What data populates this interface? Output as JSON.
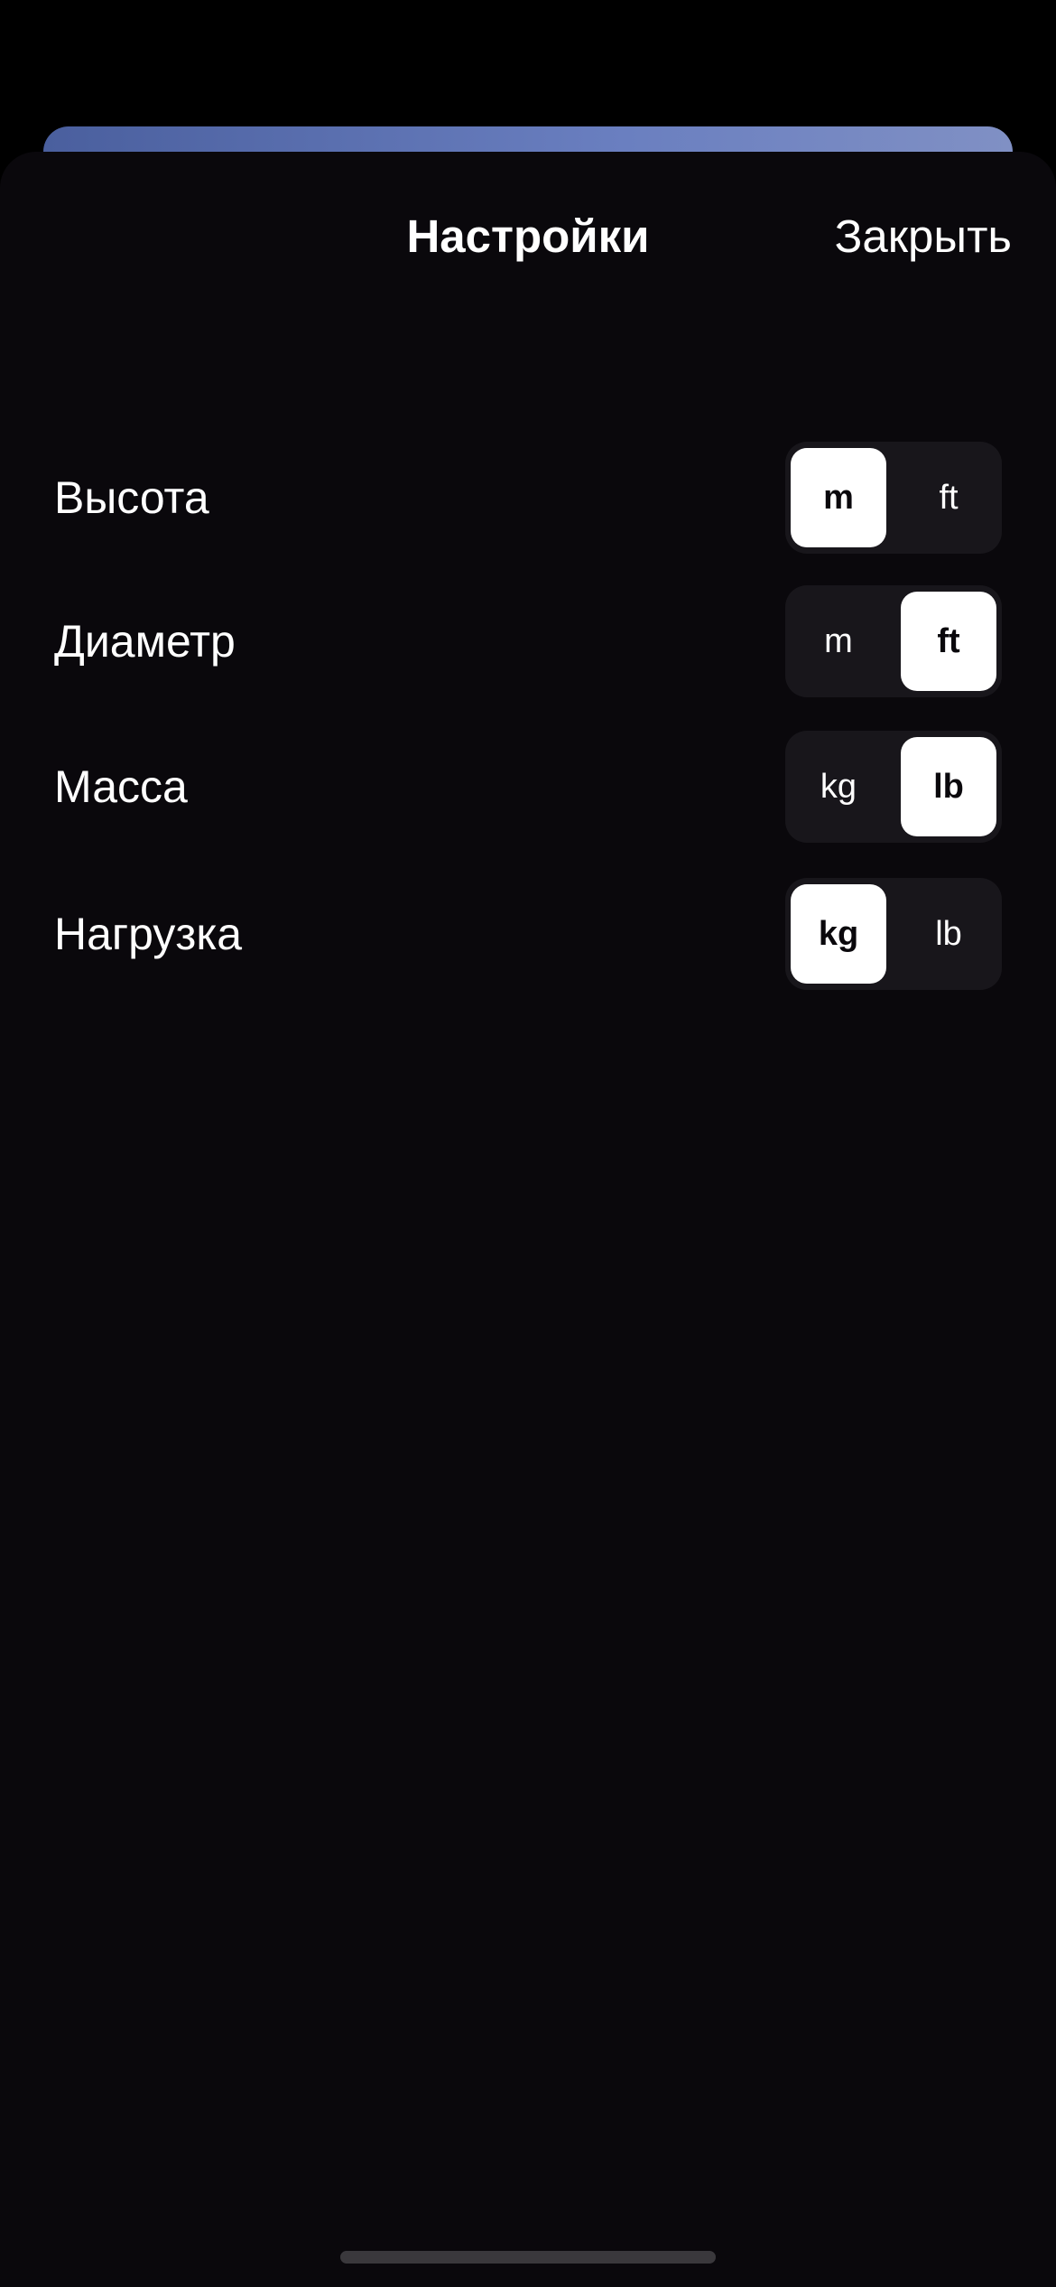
{
  "header": {
    "title": "Настройки",
    "close_label": "Закрыть"
  },
  "settings": [
    {
      "label": "Высота",
      "options": [
        "m",
        "ft"
      ],
      "selected": "m"
    },
    {
      "label": "Диаметр",
      "options": [
        "m",
        "ft"
      ],
      "selected": "ft"
    },
    {
      "label": "Масса",
      "options": [
        "kg",
        "lb"
      ],
      "selected": "lb"
    },
    {
      "label": "Нагрузка",
      "options": [
        "kg",
        "lb"
      ],
      "selected": "kg"
    }
  ],
  "colors": {
    "sheet_background": "#0a080c",
    "segment_track": "#18161b",
    "segment_selected": "#ffffff",
    "backdrop_accent": "#6a7fc0"
  }
}
